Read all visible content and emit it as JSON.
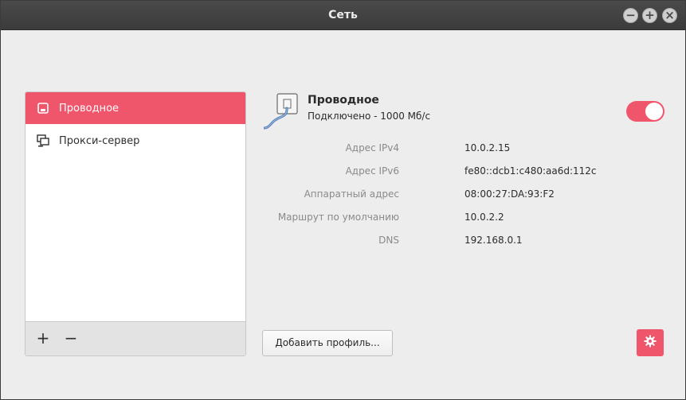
{
  "window": {
    "title": "Сеть"
  },
  "sidebar": {
    "items": [
      {
        "label": "Проводное",
        "icon": "wired-network-icon",
        "active": true
      },
      {
        "label": "Прокси-сервер",
        "icon": "proxy-server-icon",
        "active": false
      }
    ],
    "add_label": "+",
    "remove_label": "−"
  },
  "connection": {
    "name": "Проводное",
    "status": "Подключено - 1000 Мб/с",
    "enabled": true,
    "details": [
      {
        "label": "Адрес IPv4",
        "value": "10.0.2.15"
      },
      {
        "label": "Адрес IPv6",
        "value": "fe80::dcb1:c480:aa6d:112c"
      },
      {
        "label": "Аппаратный адрес",
        "value": "08:00:27:DA:93:F2"
      },
      {
        "label": "Маршрут по умолчанию",
        "value": "10.0.2.2"
      },
      {
        "label": "DNS",
        "value": "192.168.0.1"
      }
    ]
  },
  "buttons": {
    "add_profile": "Добавить профиль..."
  },
  "colors": {
    "accent": "#f0566b",
    "titlebar": "#3b3b3b",
    "window_bg": "#ededed"
  }
}
